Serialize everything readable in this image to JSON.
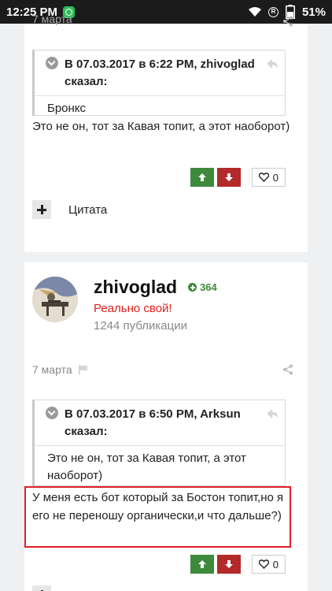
{
  "status_bar": {
    "time": "12:25 PM",
    "battery": "51%"
  },
  "top_partial_date": "7 марта",
  "post1": {
    "quote": {
      "header": "В 07.03.2017 в 6:22 PM, zhivoglad",
      "said": "сказал:",
      "body": "Бронкс"
    },
    "text": "Это не он, тот за Кавая топит, а этот наоборот)",
    "likes": "0",
    "cite_label": "Цитата"
  },
  "post2": {
    "author": {
      "name": "zhivoglad",
      "reputation": "364",
      "rank": "Реально свой!",
      "posts": "1244 публикации"
    },
    "date": "7 марта",
    "quote": {
      "header": "В 07.03.2017 в 6:50 PM, Arksun",
      "said": "сказал:",
      "body": "Это не он, тот за Кавая топит, а этот наоборот)"
    },
    "text": "У меня есть бот который за Бостон топит,но я его не переношу органически,и что дальше?)",
    "likes": "0"
  },
  "colors": {
    "upvote": "#3d8a3d",
    "downvote": "#b22a2a",
    "rank": "#e02020",
    "highlight": "#e01e2a",
    "reputation": "#3a8a3a"
  }
}
